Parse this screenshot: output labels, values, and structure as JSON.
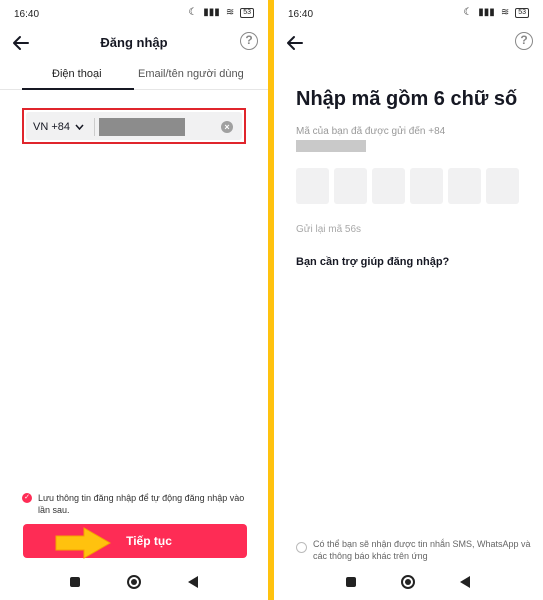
{
  "status_bar": {
    "time": "16:40",
    "battery": "53"
  },
  "login_screen": {
    "title": "Đăng nhập",
    "tabs": [
      {
        "label": "Điện thoại",
        "active": true
      },
      {
        "label": "Email/tên người dùng",
        "active": false
      }
    ],
    "country_code": "VN +84",
    "phone_value_masked": true,
    "save_login_text": "Lưu thông tin đăng nhập để tự động đăng nhập vào lần sau.",
    "save_login_checked": true,
    "continue_label": "Tiếp tục",
    "colors": {
      "primary": "#fe2c55",
      "highlight_box": "#e0252c",
      "annotation_arrow": "#ffc20e"
    }
  },
  "code_screen": {
    "heading": "Nhập mã gồm 6 chữ số",
    "sent_text": "Mã của bạn đã được gửi đến +84",
    "code_boxes": 6,
    "resend_text": "Gửi lại mã 56s",
    "help_text": "Bạn cần trợ giúp đăng nhập?",
    "sms_notice": "Có thể bạn sẽ nhận được tin nhắn SMS, WhatsApp và các thông báo khác trên ứng"
  },
  "nav_icons": [
    "recents-square-icon",
    "home-circle-icon",
    "back-triangle-icon"
  ]
}
